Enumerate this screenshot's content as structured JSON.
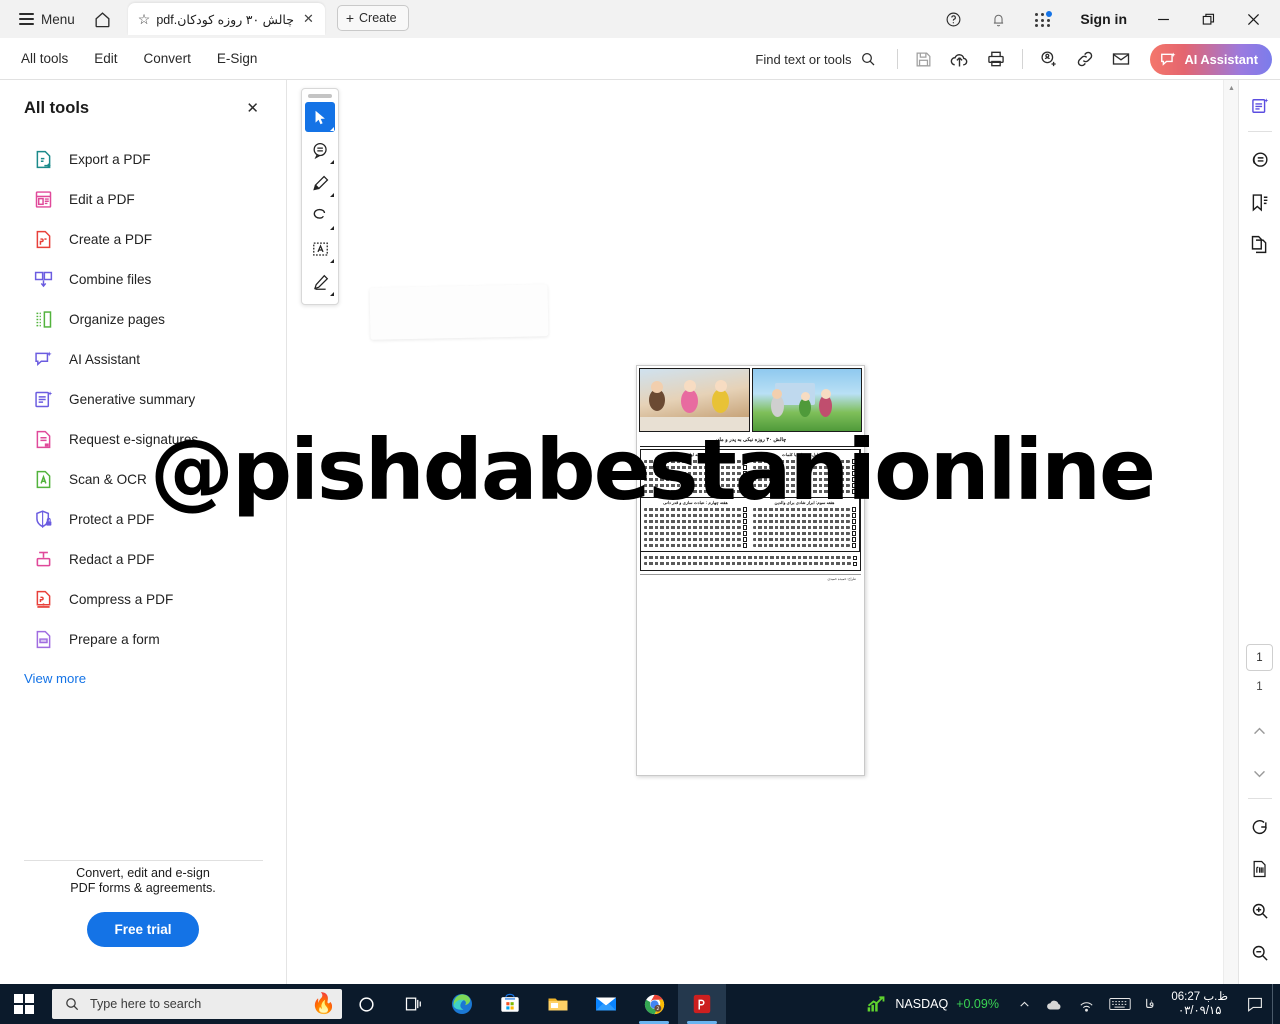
{
  "titlebar": {
    "menu_label": "Menu",
    "home_icon": "home-icon",
    "tab": {
      "star_icon": "star-icon",
      "title": "چالش ۳۰ روزه کودکان.pdf",
      "close_icon": "close-icon"
    },
    "create_label": "Create",
    "help_icon": "help-icon",
    "bell_icon": "bell-icon",
    "apps_icon": "app-grid-icon",
    "signin_label": "Sign in",
    "minimize_icon": "minimize-icon",
    "maximize_icon": "restore-icon",
    "close_icon": "close-icon"
  },
  "menubar": {
    "tabs": [
      {
        "label": "All tools"
      },
      {
        "label": "Edit"
      },
      {
        "label": "Convert"
      },
      {
        "label": "E-Sign"
      }
    ],
    "find_label": "Find text or tools",
    "find_icon": "search-icon",
    "save_icon": "save-icon",
    "upload_icon": "cloud-upload-icon",
    "print_icon": "print-icon",
    "addperson_icon": "add-person-icon",
    "link_icon": "link-icon",
    "mail_icon": "mail-icon",
    "ai_label": "AI Assistant",
    "ai_icon": "ai-sparkle-icon",
    "ai_color_start": "#f4776b",
    "ai_color_end": "#7b7ceb"
  },
  "sidebar": {
    "title": "All tools",
    "close_icon": "close-icon",
    "items": [
      {
        "label": "Export a PDF",
        "icon": "export-pdf-icon",
        "color": "#1b8a8a"
      },
      {
        "label": "Edit a PDF",
        "icon": "edit-pdf-icon",
        "color": "#e0499a"
      },
      {
        "label": "Create a PDF",
        "icon": "create-pdf-icon",
        "color": "#e8403a"
      },
      {
        "label": "Combine files",
        "icon": "combine-files-icon",
        "color": "#6b5ce0"
      },
      {
        "label": "Organize pages",
        "icon": "organize-pages-icon",
        "color": "#52b33c"
      },
      {
        "label": "AI Assistant",
        "icon": "ai-assistant-icon",
        "color": "#6b5ce0"
      },
      {
        "label": "Generative summary",
        "icon": "generative-summary-icon",
        "color": "#6b5ce0"
      },
      {
        "label": "Request e-signatures",
        "icon": "request-esign-icon",
        "color": "#e0499a"
      },
      {
        "label": "Scan & OCR",
        "icon": "scan-ocr-icon",
        "color": "#52b33c"
      },
      {
        "label": "Protect a PDF",
        "icon": "protect-pdf-icon",
        "color": "#6b5ce0"
      },
      {
        "label": "Redact a PDF",
        "icon": "redact-pdf-icon",
        "color": "#e0499a"
      },
      {
        "label": "Compress a PDF",
        "icon": "compress-pdf-icon",
        "color": "#e8403a"
      },
      {
        "label": "Prepare a form",
        "icon": "prepare-form-icon",
        "color": "#a06ce0"
      }
    ],
    "view_more_label": "View more",
    "promo_line1": "Convert, edit and e-sign",
    "promo_line2": "PDF forms & agreements.",
    "free_trial_label": "Free trial",
    "free_trial_color": "#1473e6"
  },
  "palette": {
    "buttons": [
      {
        "icon": "select-cursor-icon",
        "active": true
      },
      {
        "icon": "comment-bubble-icon",
        "active": false
      },
      {
        "icon": "highlighter-icon",
        "active": false
      },
      {
        "icon": "draw-freehand-icon",
        "active": false
      },
      {
        "icon": "text-box-icon",
        "active": false
      },
      {
        "icon": "stamp-icon",
        "active": false
      }
    ]
  },
  "document": {
    "watermark": "@pishdabestanionline",
    "title": "چالش ۳۰ روزه نیکی به پدر و مادر",
    "columns": [
      {
        "heading": "هفته اول: همدلی با کلمات",
        "items": 6
      },
      {
        "heading": "هفته اول",
        "items": 6
      }
    ],
    "sections": [
      {
        "heading": "هفته سوم: ابراز شادی برای والدین",
        "items": 7
      },
      {
        "heading": "هفته چهارم : عبادت سازی و قدر دانی",
        "items": 7
      }
    ],
    "footnote": "طراح: حمیده حمیدی"
  },
  "rail": {
    "buttons_top": [
      {
        "icon": "generative-summary-icon"
      },
      {
        "icon": "comment-bubble-icon"
      },
      {
        "icon": "bookmark-icon"
      },
      {
        "icon": "page-thumbnails-icon"
      }
    ],
    "page_current": "1",
    "page_total": "1",
    "prev_icon": "chevron-up-icon",
    "next_icon": "chevron-down-icon",
    "buttons_bottom": [
      {
        "icon": "rotate-icon"
      },
      {
        "icon": "fit-page-icon"
      },
      {
        "icon": "zoom-in-icon"
      },
      {
        "icon": "zoom-out-icon"
      }
    ]
  },
  "taskbar": {
    "start_icon": "windows-start-icon",
    "search_placeholder": "Type here to search",
    "search_icon": "search-icon",
    "fireplace_icon": "fireplace-icon",
    "cortana_icon": "cortana-circle-icon",
    "taskview_icon": "task-view-icon",
    "apps": [
      {
        "icon": "edge-icon"
      },
      {
        "icon": "microsoft-store-icon"
      },
      {
        "icon": "file-explorer-icon"
      },
      {
        "icon": "mail-icon"
      },
      {
        "icon": "chrome-icon"
      },
      {
        "icon": "acrobat-reader-icon"
      }
    ],
    "stock_name": "NASDAQ",
    "stock_change": "+0.09%",
    "stock_color": "#39d353",
    "chevron_icon": "chevron-up-icon",
    "onedrive_icon": "onedrive-icon",
    "network_icon": "network-icon",
    "keyboard_icon": "keyboard-icon",
    "language": "فا",
    "time": "06:27 ظ.ب",
    "date": "۰۳/۰۹/۱۵",
    "notification_icon": "notification-icon"
  }
}
